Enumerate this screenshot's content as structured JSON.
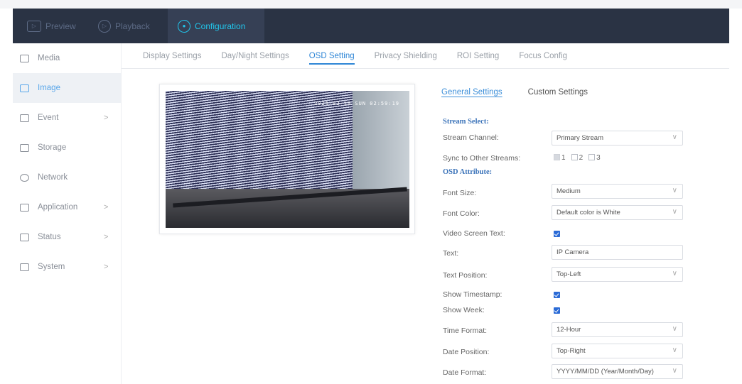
{
  "topnav": [
    {
      "label": "Preview",
      "icon": "preview-icon"
    },
    {
      "label": "Playback",
      "icon": "playback-icon"
    },
    {
      "label": "Configuration",
      "icon": "configuration-icon"
    }
  ],
  "sidebar": {
    "items": [
      {
        "label": "Media",
        "icon": "media-icon",
        "chevron": ""
      },
      {
        "label": "Image",
        "icon": "image-icon",
        "chevron": ""
      },
      {
        "label": "Event",
        "icon": "event-icon",
        "chevron": ">"
      },
      {
        "label": "Storage",
        "icon": "storage-icon",
        "chevron": ""
      },
      {
        "label": "Network",
        "icon": "network-icon",
        "chevron": ""
      },
      {
        "label": "Application",
        "icon": "application-icon",
        "chevron": ">"
      },
      {
        "label": "Status",
        "icon": "status-icon",
        "chevron": ">"
      },
      {
        "label": "System",
        "icon": "system-icon",
        "chevron": ">"
      }
    ]
  },
  "tabs": [
    "Display Settings",
    "Day/Night Settings",
    "OSD Setting",
    "Privacy Shielding",
    "ROI Setting",
    "Focus Config"
  ],
  "preview": {
    "osd_text": "2025-02-10 SUN 02:59:19"
  },
  "subtabs": [
    "General Settings",
    "Custom Settings"
  ],
  "form": {
    "stream_select_title": "Stream Select:",
    "stream_channel_label": "Stream Channel:",
    "stream_channel_value": "Primary Stream",
    "sync_label": "Sync to Other Streams:",
    "sync_1": "1",
    "sync_2": "2",
    "sync_3": "3",
    "osd_attribute_title": "OSD Attribute:",
    "font_size_label": "Font Size:",
    "font_size_value": "Medium",
    "font_color_label": "Font Color:",
    "font_color_value": "Default color is White",
    "video_screen_text_label": "Video Screen Text:",
    "text_label": "Text:",
    "text_value": "IP Camera",
    "text_position_label": "Text Position:",
    "text_position_value": "Top-Left",
    "show_timestamp_label": "Show Timestamp:",
    "show_week_label": "Show Week:",
    "time_format_label": "Time Format:",
    "time_format_value": "12-Hour",
    "date_position_label": "Date Position:",
    "date_position_value": "Top-Right",
    "date_format_label": "Date Format:",
    "date_format_value": "YYYY/MM/DD (Year/Month/Day)"
  },
  "colors": {
    "topbar": "#2a3344",
    "accent": "#21c6ec",
    "link": "#2f86d6",
    "checkbox": "#2b6bd6"
  }
}
